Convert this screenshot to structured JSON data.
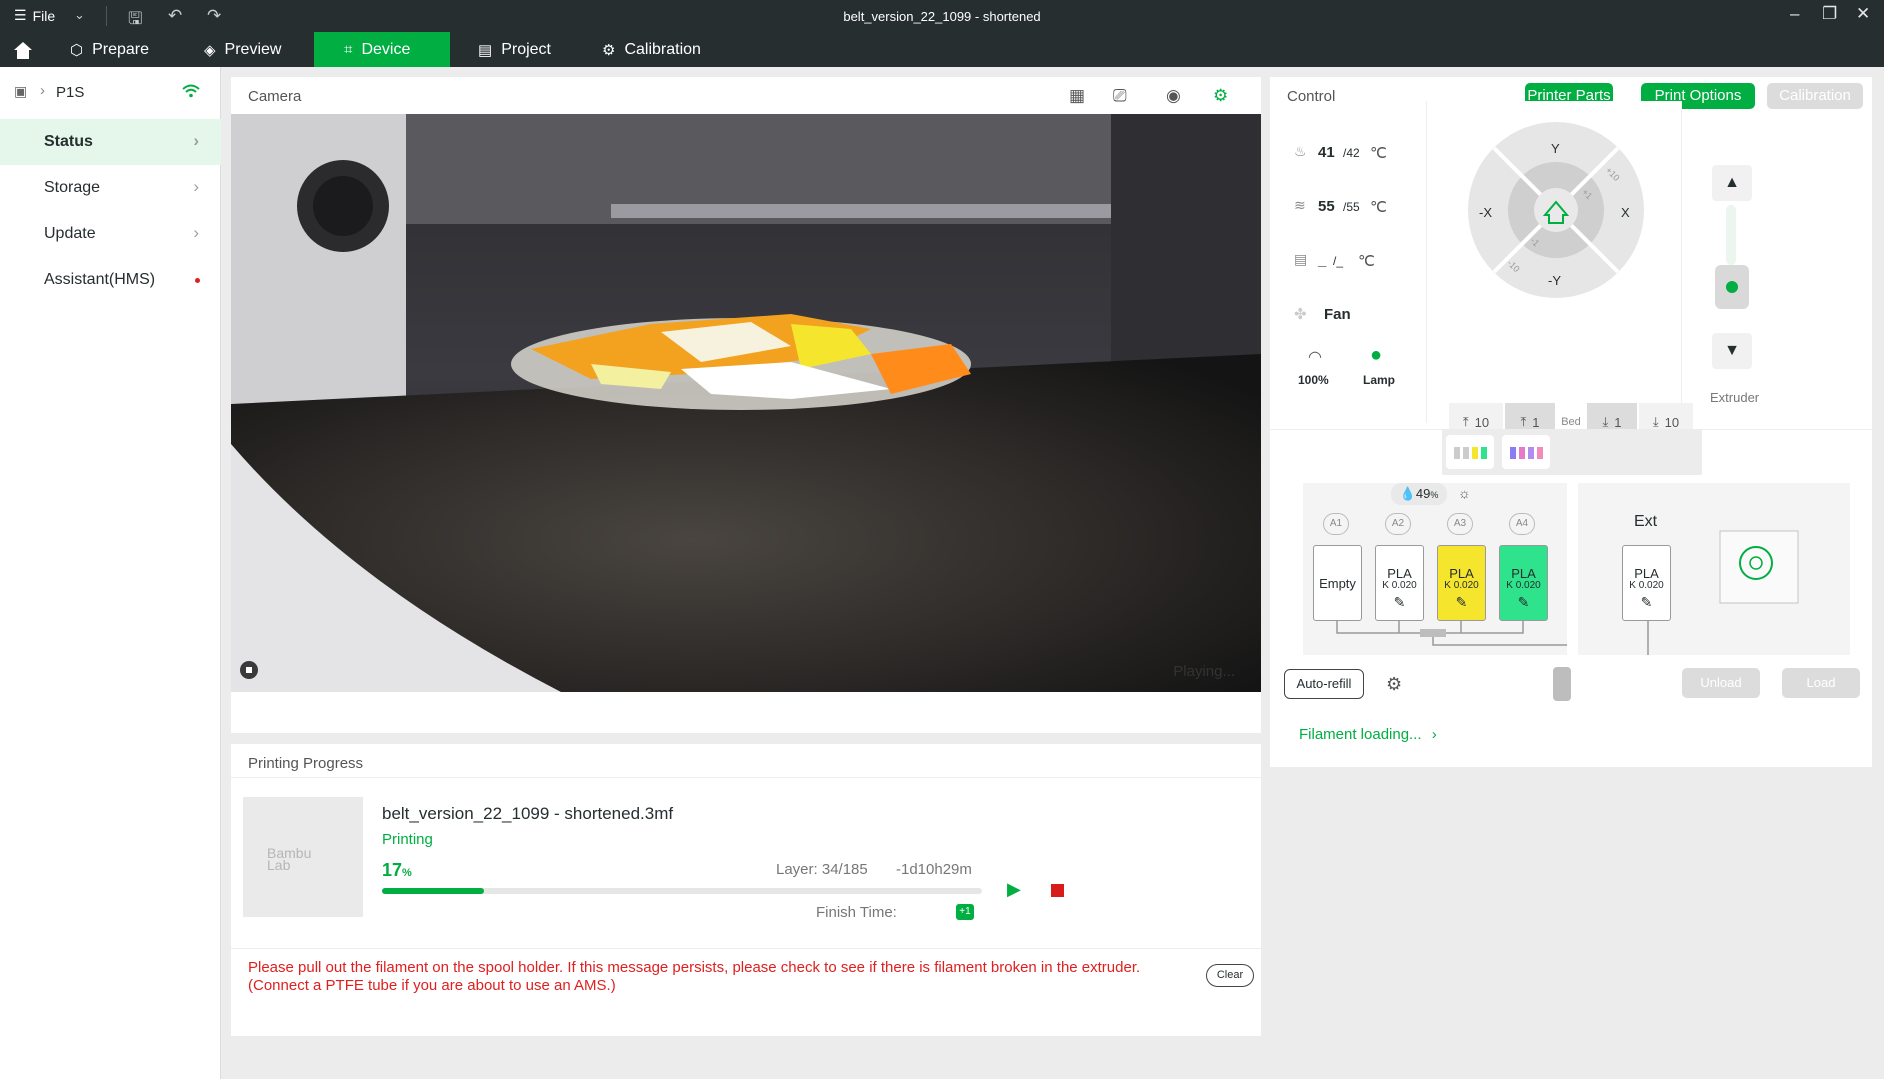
{
  "window": {
    "title": "belt_version_22_1099 - shortened",
    "menu_label": "File"
  },
  "tabs": [
    {
      "label": "Prepare",
      "icon": "cube-icon"
    },
    {
      "label": "Preview",
      "icon": "layers-icon"
    },
    {
      "label": "Device",
      "icon": "device-icon"
    },
    {
      "label": "Project",
      "icon": "project-icon"
    },
    {
      "label": "Calibration",
      "icon": "calibration-icon"
    }
  ],
  "sidebar": {
    "printer_name": "P1S",
    "items": [
      {
        "label": "Status"
      },
      {
        "label": "Storage"
      },
      {
        "label": "Update"
      },
      {
        "label": "Assistant(HMS)"
      }
    ]
  },
  "camera": {
    "title": "Camera",
    "status": "Playing..."
  },
  "progress": {
    "title": "Printing Progress",
    "file_name": "belt_version_22_1099 - shortened.3mf",
    "state": "Printing",
    "percent_value": "17",
    "percent_unit": "%",
    "percent": 17,
    "layer": "Layer: 34/185",
    "remaining": "-1d10h29m",
    "finish_label": "Finish Time:",
    "day_badge": "+1",
    "thumb_logo_1": "Bambu",
    "thumb_logo_2": "Lab",
    "error_line1": "Please pull out the filament on the spool holder. If this message persists, please check to see if there is filament broken in the extruder.",
    "error_line2": "(Connect a PTFE tube if you are about to use an AMS.)",
    "clear_label": "Clear"
  },
  "control": {
    "title": "Control",
    "buttons": {
      "printer_parts": "Printer Parts",
      "print_options": "Print Options",
      "calibration": "Calibration"
    },
    "nozzle_temp": "41",
    "nozzle_target": "/42",
    "bed_temp": "55",
    "bed_target": "/55",
    "chamber_temp": "_",
    "chamber_target": "/_",
    "unit": "℃",
    "fan_label": "Fan",
    "speed_label": "100%",
    "lamp_label": "Lamp",
    "jog": {
      "y_plus": "Y",
      "y_minus": "-Y",
      "x_plus": "X",
      "x_minus": "-X",
      "p10": "+10",
      "p1": "+1",
      "m1": "-1",
      "m10": "-10"
    },
    "bed_buttons": {
      "up10": "10",
      "up1": "1",
      "bed": "Bed",
      "down1": "1",
      "down10": "10"
    },
    "extruder_label": "Extruder"
  },
  "ams": {
    "humidity_value": "49",
    "humidity_unit": "%",
    "slots": [
      {
        "id": "A1",
        "label": "Empty",
        "color": "#ffffff"
      },
      {
        "id": "A2",
        "label": "PLA",
        "k": "K 0.020",
        "color": "#ffffff"
      },
      {
        "id": "A3",
        "label": "PLA",
        "k": "K 0.020",
        "color": "#f5e62d"
      },
      {
        "id": "A4",
        "label": "PLA",
        "k": "K 0.020",
        "color": "#2fe28c"
      }
    ],
    "ext_label": "Ext",
    "ext_slot": {
      "label": "PLA",
      "k": "K 0.020"
    },
    "auto_refill": "Auto-refill",
    "unload": "Unload",
    "load": "Load",
    "filament_loading": "Filament loading..."
  },
  "colors": {
    "accent": "#00ae42",
    "titlebar": "#262e30",
    "error": "#e02020"
  }
}
